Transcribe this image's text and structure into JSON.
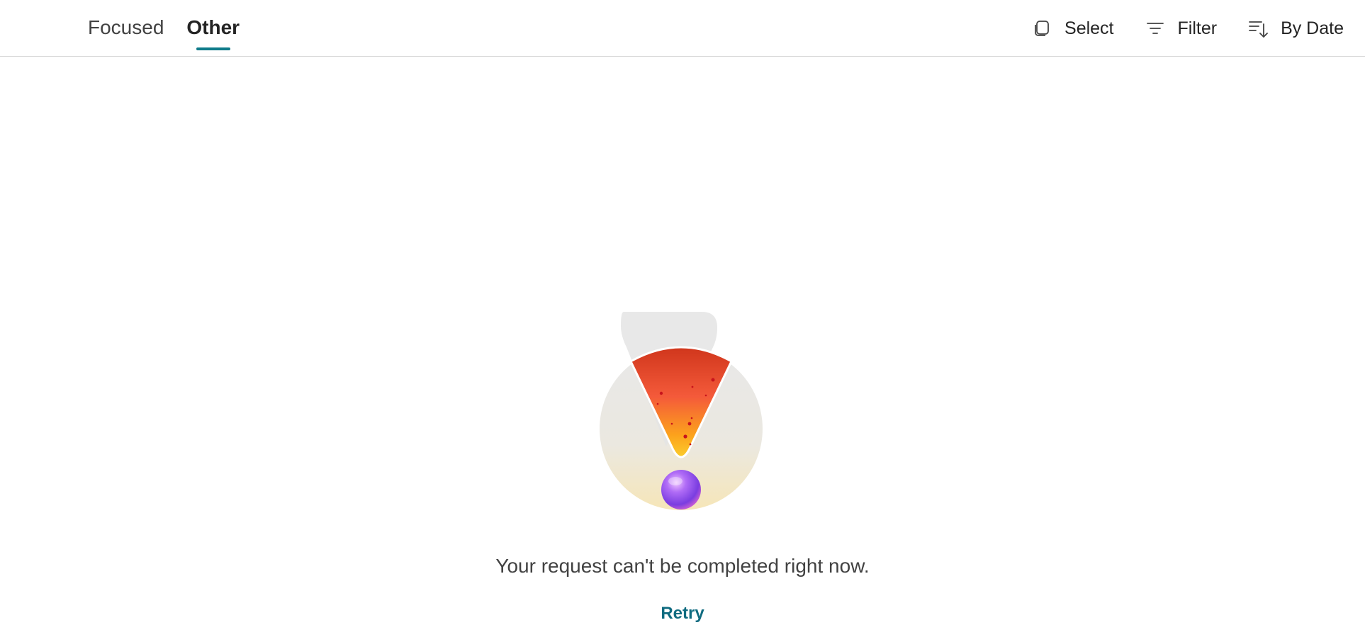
{
  "tabs": [
    {
      "label": "Focused",
      "active": false
    },
    {
      "label": "Other",
      "active": true
    }
  ],
  "toolbar": {
    "select_label": "Select",
    "filter_label": "Filter",
    "sort_label": "By Date",
    "select_icon": "select-square-icon",
    "filter_icon": "filter-lines-icon",
    "sort_icon": "sort-descending-icon"
  },
  "error": {
    "illustration": "exclamation-warning-illustration",
    "message": "Your request can't be completed right now.",
    "retry_label": "Retry"
  },
  "colors": {
    "accent": "#0f7b8a",
    "link": "#0f6b80",
    "divider": "#d6d6d6"
  }
}
